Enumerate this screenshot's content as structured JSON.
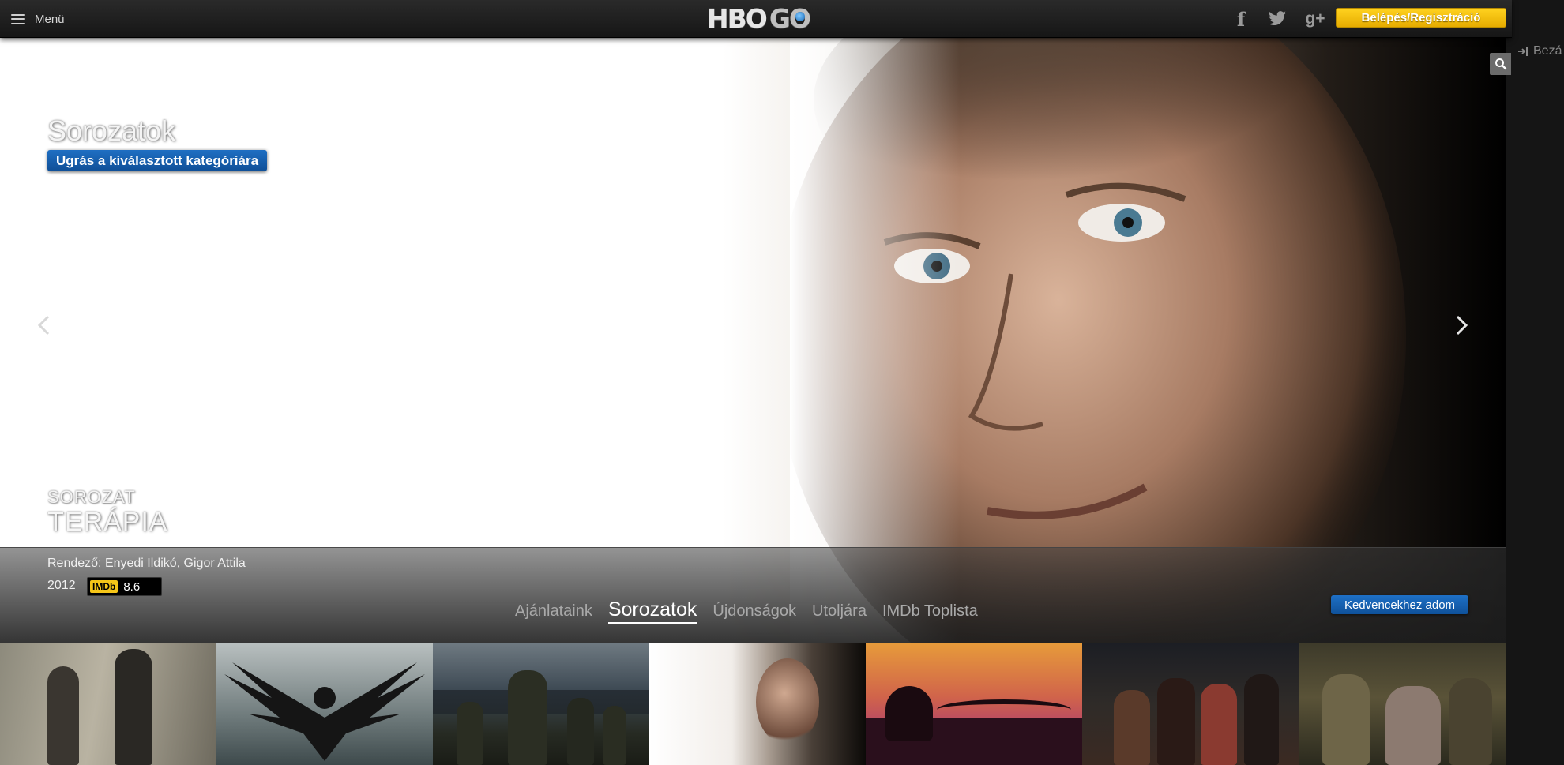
{
  "header": {
    "menu_label": "Menü",
    "logo_hbo": "HBO",
    "logo_go": "GO",
    "social": {
      "facebook": "f",
      "twitter_icon": "twitter-bird",
      "googleplus": "g+"
    },
    "login_label": "Belépés/Regisztráció"
  },
  "side_panel": {
    "close_label": "Bezá"
  },
  "hero": {
    "category_title": "Sorozatok",
    "jump_button_label": "Ugrás a kiválasztott kategóriára",
    "type_label": "SOROZAT",
    "title": "TERÁPIA",
    "director": "Rendező: Enyedi Ildikó, Gigor Attila",
    "year": "2012",
    "imdb_label": "IMDb",
    "imdb_score": "8.6",
    "favorite_label": "Kedvencekhez adom"
  },
  "tabs": [
    {
      "label": "Ajánlataink",
      "active": false
    },
    {
      "label": "Sorozatok",
      "active": true
    },
    {
      "label": "Újdonságok",
      "active": false
    },
    {
      "label": "Utoljára",
      "active": false
    },
    {
      "label": "IMDb Toplista",
      "active": false
    }
  ],
  "colors": {
    "login_yellow": "#ffd21f",
    "button_blue": "#1f6fc3",
    "imdb_yellow": "#f5c518"
  }
}
